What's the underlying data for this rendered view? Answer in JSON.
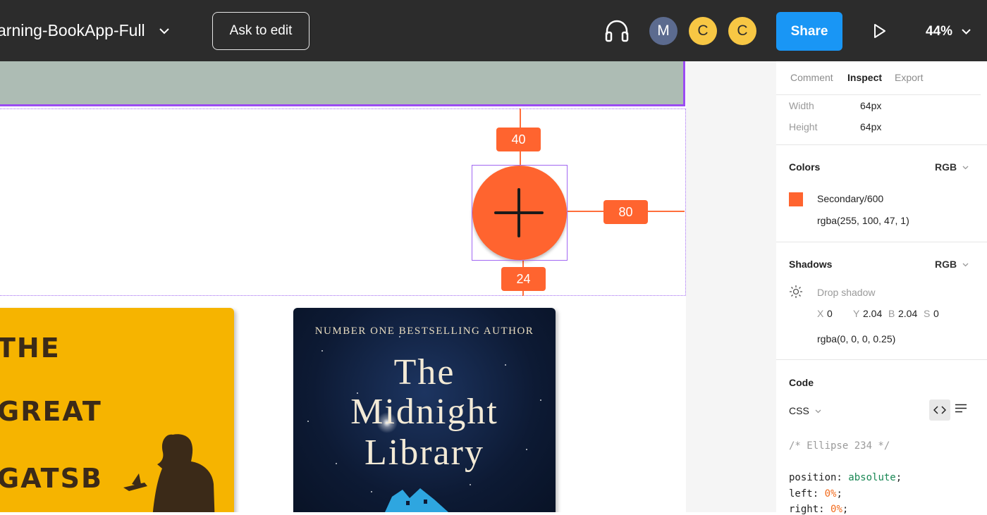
{
  "topbar": {
    "file_title": "arning-BookApp-Full",
    "ask_to_edit": "Ask to edit",
    "avatars": [
      "M",
      "C",
      "C"
    ],
    "share": "Share",
    "zoom": "44%"
  },
  "canvas": {
    "measurements": {
      "top": "40",
      "right": "80",
      "bottom": "24"
    },
    "books": {
      "gatsby": {
        "lines": [
          "THE",
          "GREAT",
          "GATSB"
        ]
      },
      "midnight": {
        "author": "NUMBER ONE BESTSELLING AUTHOR",
        "title_lines": [
          "The",
          "Midnight",
          "Library"
        ]
      }
    }
  },
  "panel": {
    "tabs": [
      "Comment",
      "Inspect",
      "Export"
    ],
    "active_tab": "Inspect",
    "width_label": "Width",
    "width_value": "64px",
    "height_label": "Height",
    "height_value": "64px",
    "colors": {
      "title": "Colors",
      "mode": "RGB",
      "name": "Secondary/600",
      "value": "rgba(255, 100, 47, 1)",
      "swatch_hex": "#ff642f"
    },
    "shadows": {
      "title": "Shadows",
      "mode": "RGB",
      "type": "Drop shadow",
      "x_label": "X",
      "x": "0",
      "y_label": "Y",
      "y": "2.04",
      "b_label": "B",
      "b": "2.04",
      "s_label": "S",
      "s": "0",
      "color": "rgba(0, 0, 0, 0.25)"
    },
    "code": {
      "title": "Code",
      "language": "CSS",
      "comment": "/* Ellipse 234 */",
      "lines": [
        {
          "prop": "position: ",
          "val": "absolute",
          "cls": "kw"
        },
        {
          "prop": "left: ",
          "val": "0%",
          "cls": "num"
        },
        {
          "prop": "right: ",
          "val": "0%",
          "cls": "num"
        }
      ]
    }
  }
}
